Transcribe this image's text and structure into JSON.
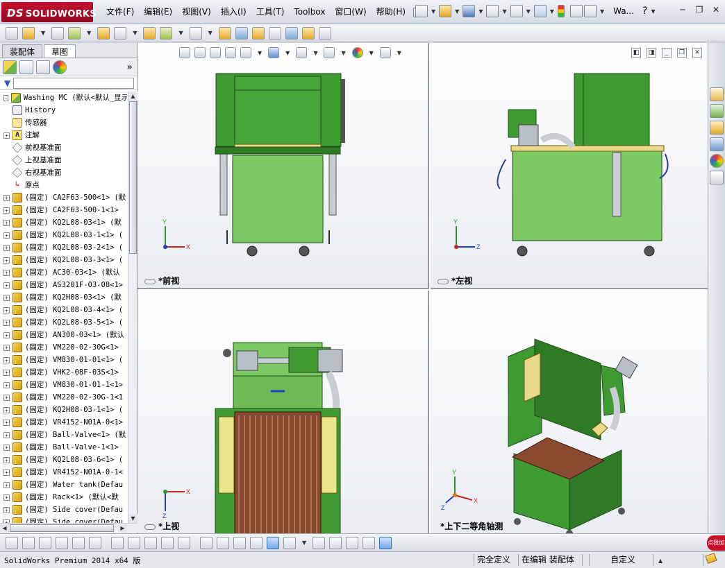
{
  "app": {
    "logo_ds": "DS",
    "logo_name": "SOLIDWORKS",
    "doc_title_short": "Wa...",
    "help_label": "?"
  },
  "menu": [
    "文件(F)",
    "编辑(E)",
    "视图(V)",
    "插入(I)",
    "工具(T)",
    "Toolbox",
    "窗口(W)",
    "帮助(H)"
  ],
  "left_panel": {
    "tabs": [
      "装配体",
      "草图"
    ],
    "active_tab": "草图",
    "expand_label": "»",
    "tree": [
      {
        "exp": "-",
        "icon": "asm",
        "label": "Washing MC  (默认<默认_显示"
      },
      {
        "exp": "",
        "icon": "hist",
        "label": "History"
      },
      {
        "exp": "",
        "icon": "sens",
        "label": "传感器"
      },
      {
        "exp": "+",
        "icon": "ann",
        "label": "注解"
      },
      {
        "exp": "",
        "icon": "plane",
        "label": "前视基准面"
      },
      {
        "exp": "",
        "icon": "plane",
        "label": "上视基准面"
      },
      {
        "exp": "",
        "icon": "plane",
        "label": "右视基准面"
      },
      {
        "exp": "",
        "icon": "origin",
        "label": "原点"
      },
      {
        "exp": "+",
        "icon": "part",
        "label": "(固定) CA2F63-500<1> (默"
      },
      {
        "exp": "+",
        "icon": "part",
        "label": "(固定) CA2F63-500-1<1>"
      },
      {
        "exp": "+",
        "icon": "part",
        "label": "(固定) KQ2L08-03<1> (默"
      },
      {
        "exp": "+",
        "icon": "part",
        "label": "(固定) KQ2L08-03-1<1> ("
      },
      {
        "exp": "+",
        "icon": "part",
        "label": "(固定) KQ2L08-03-2<1> ("
      },
      {
        "exp": "+",
        "icon": "part",
        "label": "(固定) KQ2L08-03-3<1> ("
      },
      {
        "exp": "+",
        "icon": "part",
        "label": "(固定) AC30-03<1> (默认"
      },
      {
        "exp": "+",
        "icon": "part",
        "label": "(固定) AS3201F-03-08<1>"
      },
      {
        "exp": "+",
        "icon": "part",
        "label": "(固定) KQ2H08-03<1> (默"
      },
      {
        "exp": "+",
        "icon": "part",
        "label": "(固定) KQ2L08-03-4<1> ("
      },
      {
        "exp": "+",
        "icon": "part",
        "label": "(固定) KQ2L08-03-5<1> ("
      },
      {
        "exp": "+",
        "icon": "part",
        "label": "(固定) AN300-03<1> (默认"
      },
      {
        "exp": "+",
        "icon": "part",
        "label": "(固定) VM220-02-30G<1>"
      },
      {
        "exp": "+",
        "icon": "part",
        "label": "(固定) VM830-01-01<1> ("
      },
      {
        "exp": "+",
        "icon": "part",
        "label": "(固定) VHK2-08F-03S<1>"
      },
      {
        "exp": "+",
        "icon": "part",
        "label": "(固定) VM830-01-01-1<1>"
      },
      {
        "exp": "+",
        "icon": "part",
        "label": "(固定) VM220-02-30G-1<1"
      },
      {
        "exp": "+",
        "icon": "part",
        "label": "(固定) KQ2H08-03-1<1> ("
      },
      {
        "exp": "+",
        "icon": "part",
        "label": "(固定) VR4152-N01A-0<1>"
      },
      {
        "exp": "+",
        "icon": "part",
        "label": "(固定) Ball-Valve<1> (默"
      },
      {
        "exp": "+",
        "icon": "part",
        "label": "(固定) Ball-Valve-1<1>"
      },
      {
        "exp": "+",
        "icon": "part",
        "label": "(固定) KQ2L08-03-6<1> ("
      },
      {
        "exp": "+",
        "icon": "part",
        "label": "(固定) VR4152-N01A-0-1<"
      },
      {
        "exp": "+",
        "icon": "part",
        "label": "(固定) Water tank(Defau"
      },
      {
        "exp": "+",
        "icon": "part",
        "label": "(固定) Rack<1> (默认<默"
      },
      {
        "exp": "+",
        "icon": "part",
        "label": "(固定) Side cover(Defau"
      },
      {
        "exp": "+",
        "icon": "part",
        "label": "(固定) Side cover(Defau"
      }
    ]
  },
  "viewports": [
    {
      "label": "*前视",
      "axes": [
        "X",
        "Y"
      ]
    },
    {
      "label": "*左视",
      "axes": [
        "Z",
        "Y"
      ]
    },
    {
      "label": "*上视",
      "axes": [
        "X",
        "Z"
      ]
    },
    {
      "label": "*上下二等角轴测",
      "axes": [
        "X",
        "Y",
        "Z"
      ]
    }
  ],
  "status": {
    "product": "SolidWorks Premium 2014 x64 版",
    "constraint": "完全定义",
    "mode": "在编辑 装配体",
    "units": "自定义",
    "hint_badge": "点我加"
  },
  "colors": {
    "machine_green": "#3f9a32",
    "machine_light_green": "#7cc862",
    "dark_green": "#2f7a25",
    "accent_red": "#c8102e"
  }
}
